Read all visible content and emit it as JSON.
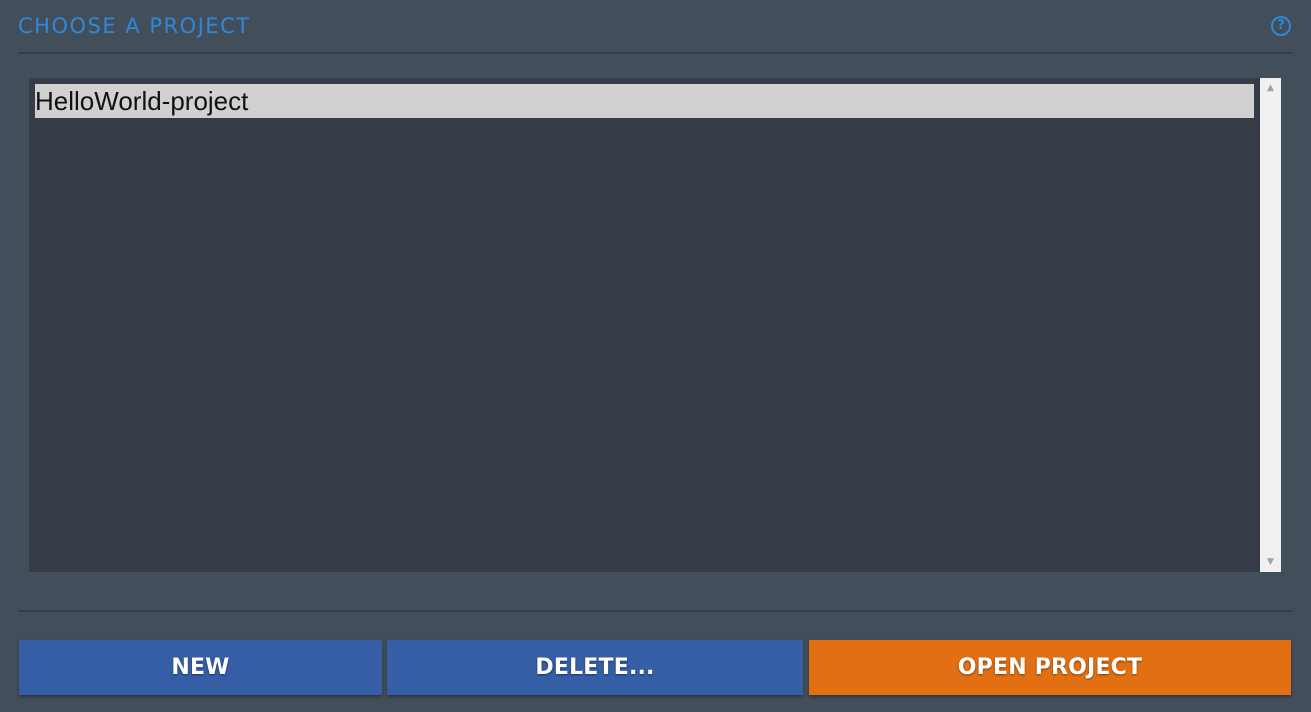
{
  "header": {
    "title": "CHOOSE A PROJECT",
    "help_icon": "?"
  },
  "projects": {
    "items": [
      {
        "label": "HelloWorld-project",
        "selected": true
      }
    ]
  },
  "scrollbar": {
    "up_arrow": "▲",
    "down_arrow": "▼"
  },
  "actions": {
    "new_label": "NEW",
    "delete_label": "DELETE...",
    "open_label": "OPEN PROJECT"
  },
  "colors": {
    "accent": "#2f88d8",
    "primary_button": "#365ea6",
    "open_button": "#e27012",
    "background": "#434e5b",
    "list_background": "#363c47",
    "selected_item": "#d0d0d0"
  }
}
